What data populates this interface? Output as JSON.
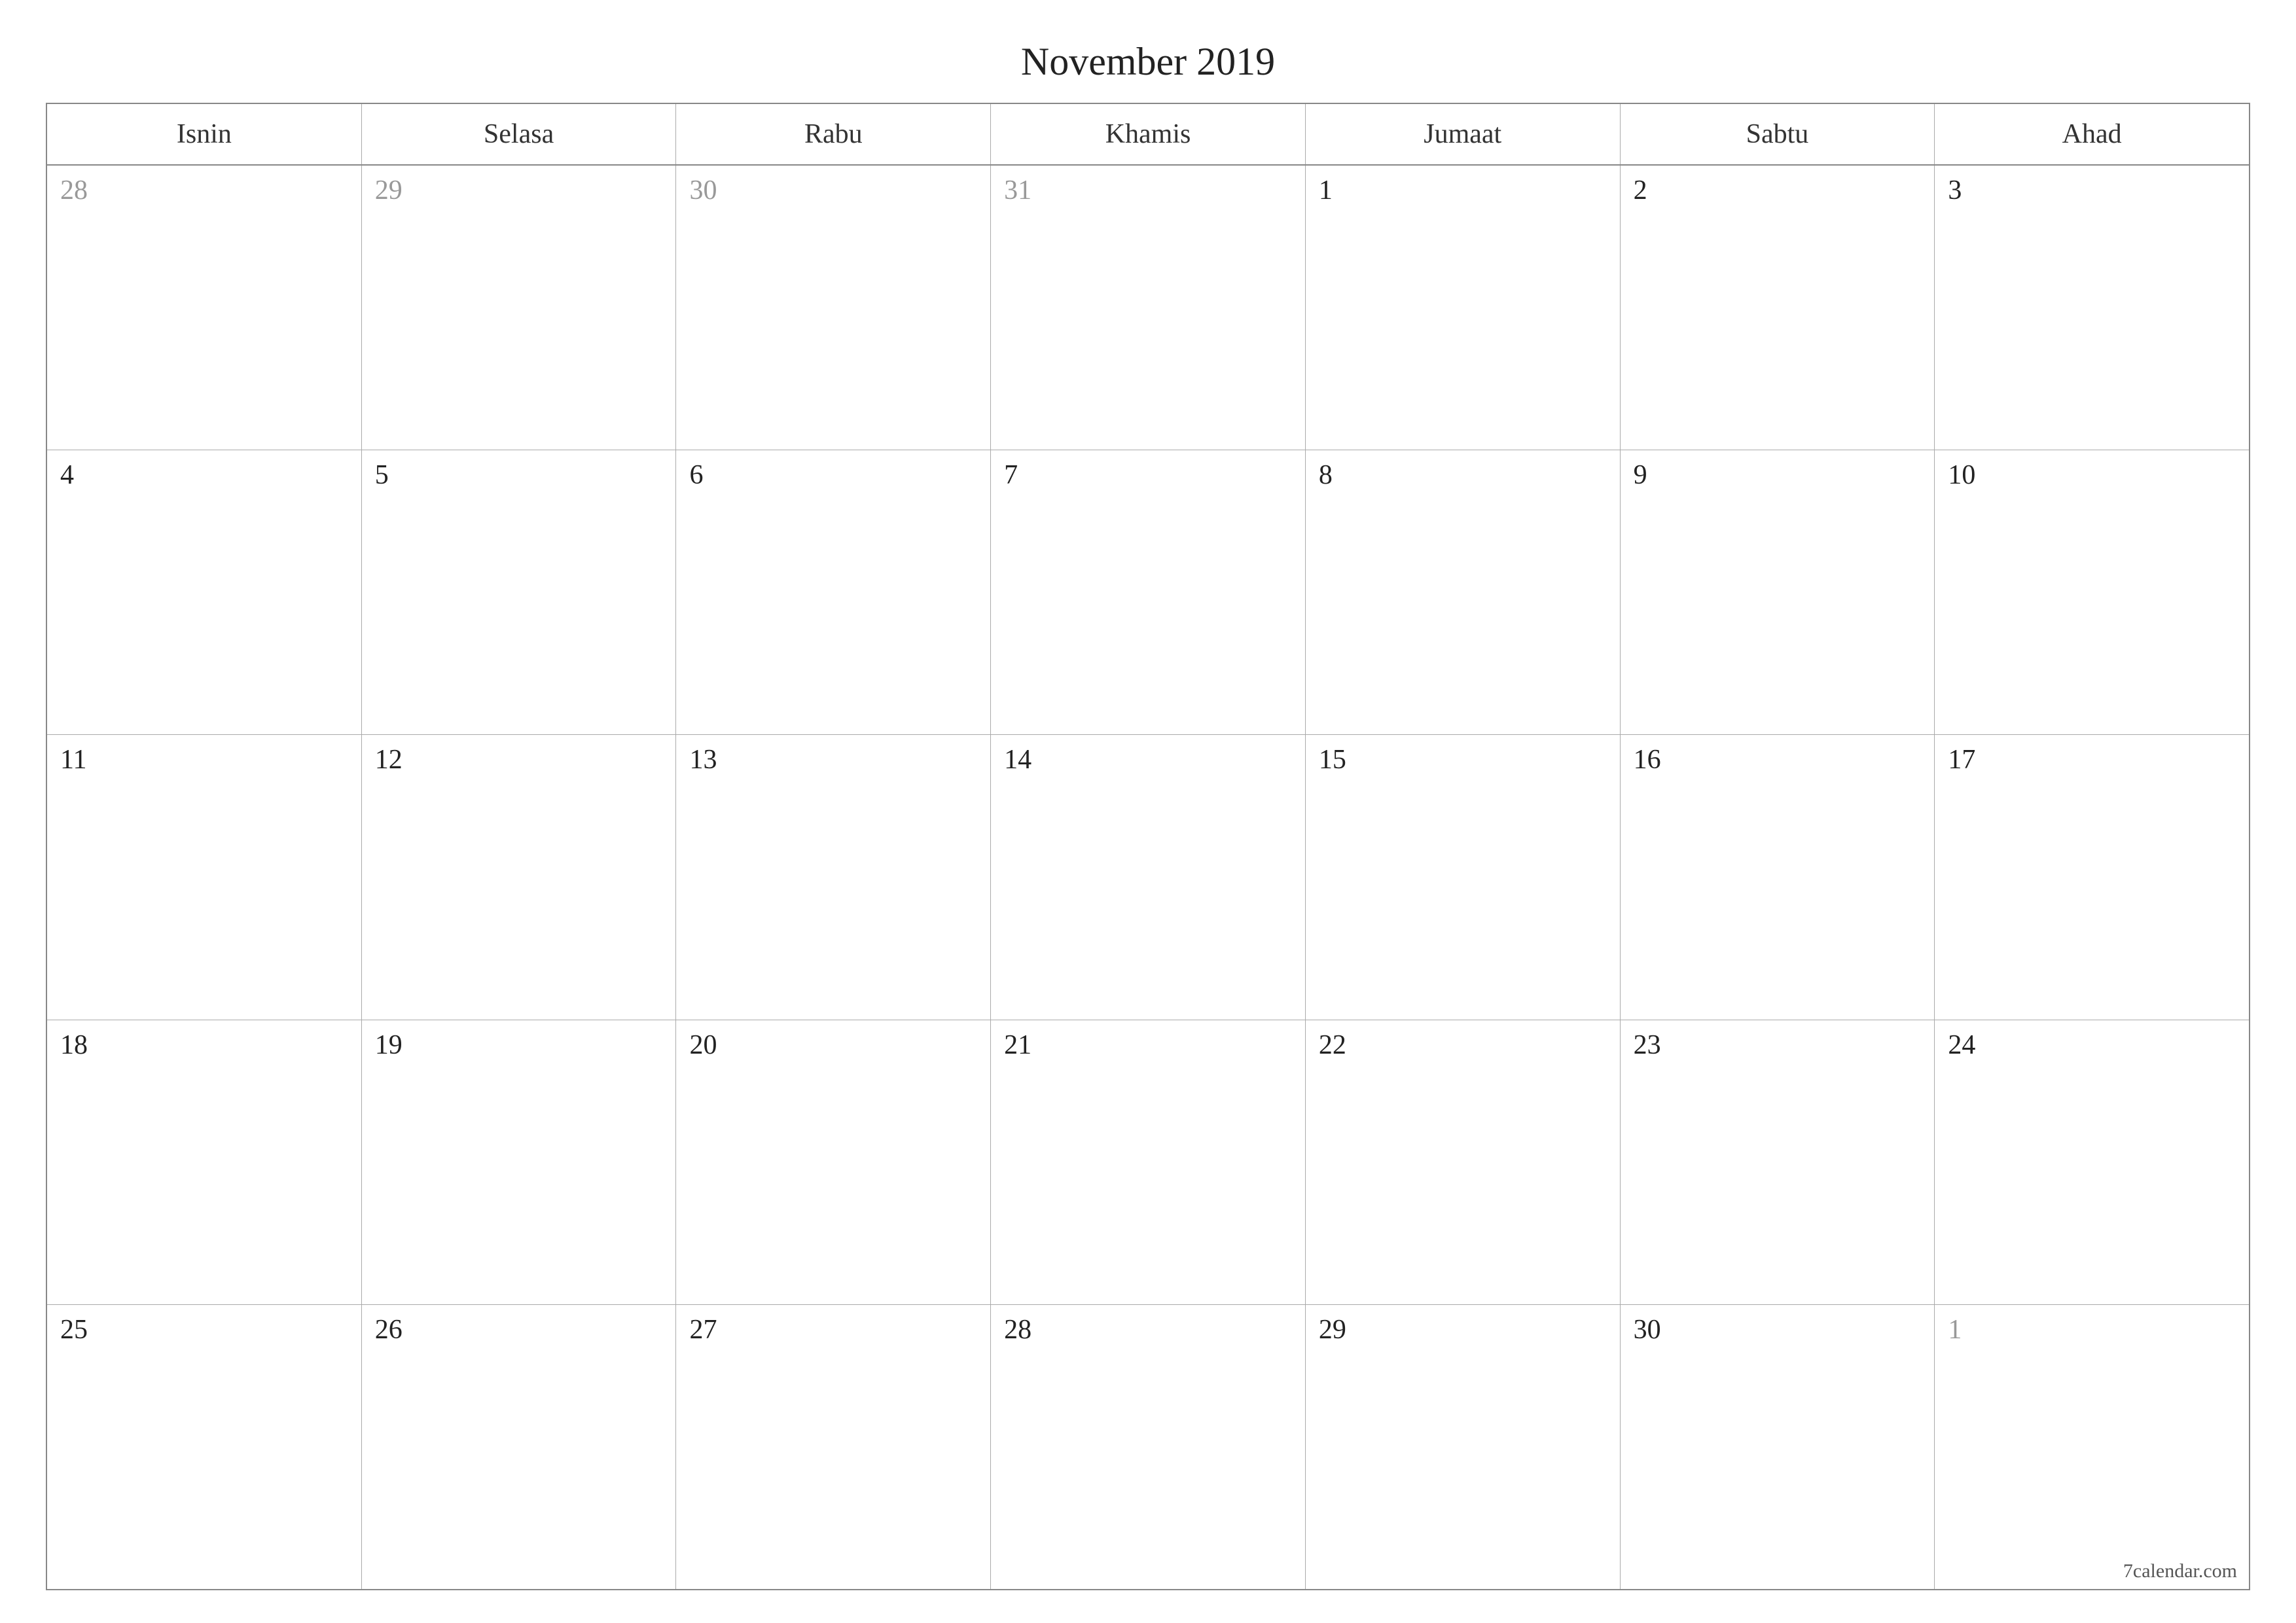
{
  "title": "November 2019",
  "weekdays": [
    "Isnin",
    "Selasa",
    "Rabu",
    "Khamis",
    "Jumaat",
    "Sabtu",
    "Ahad"
  ],
  "weeks": [
    [
      {
        "day": "28",
        "other": true
      },
      {
        "day": "29",
        "other": true
      },
      {
        "day": "30",
        "other": true
      },
      {
        "day": "31",
        "other": true
      },
      {
        "day": "1",
        "other": false
      },
      {
        "day": "2",
        "other": false
      },
      {
        "day": "3",
        "other": false
      }
    ],
    [
      {
        "day": "4",
        "other": false
      },
      {
        "day": "5",
        "other": false
      },
      {
        "day": "6",
        "other": false
      },
      {
        "day": "7",
        "other": false
      },
      {
        "day": "8",
        "other": false
      },
      {
        "day": "9",
        "other": false
      },
      {
        "day": "10",
        "other": false
      }
    ],
    [
      {
        "day": "11",
        "other": false
      },
      {
        "day": "12",
        "other": false
      },
      {
        "day": "13",
        "other": false
      },
      {
        "day": "14",
        "other": false
      },
      {
        "day": "15",
        "other": false
      },
      {
        "day": "16",
        "other": false
      },
      {
        "day": "17",
        "other": false
      }
    ],
    [
      {
        "day": "18",
        "other": false
      },
      {
        "day": "19",
        "other": false
      },
      {
        "day": "20",
        "other": false
      },
      {
        "day": "21",
        "other": false
      },
      {
        "day": "22",
        "other": false
      },
      {
        "day": "23",
        "other": false
      },
      {
        "day": "24",
        "other": false
      }
    ],
    [
      {
        "day": "25",
        "other": false
      },
      {
        "day": "26",
        "other": false
      },
      {
        "day": "27",
        "other": false
      },
      {
        "day": "28",
        "other": false
      },
      {
        "day": "29",
        "other": false
      },
      {
        "day": "30",
        "other": false
      },
      {
        "day": "1",
        "other": true
      }
    ]
  ],
  "footer": "7calendar.com"
}
